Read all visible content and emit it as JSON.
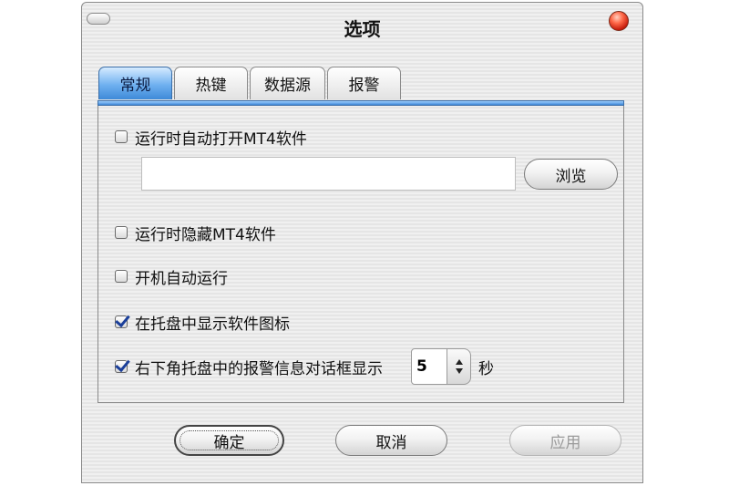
{
  "window": {
    "title": "选项"
  },
  "tabs": [
    {
      "label": "常规",
      "active": true
    },
    {
      "label": "热键",
      "active": false
    },
    {
      "label": "数据源",
      "active": false
    },
    {
      "label": "报警",
      "active": false
    }
  ],
  "general": {
    "auto_open_mt4": {
      "label": "运行时自动打开MT4软件",
      "checked": false
    },
    "mt4_path": {
      "value": "",
      "placeholder": ""
    },
    "browse_label": "浏览",
    "hide_mt4": {
      "label": "运行时隐藏MT4软件",
      "checked": false
    },
    "startup": {
      "label": "开机自动运行",
      "checked": false
    },
    "tray_icon": {
      "label": "在托盘中显示软件图标",
      "checked": true
    },
    "tray_alert": {
      "label": "右下角托盘中的报警信息对话框显示",
      "checked": true,
      "seconds": "5",
      "unit": "秒"
    }
  },
  "buttons": {
    "ok": "确定",
    "cancel": "取消",
    "apply": "应用"
  },
  "colors": {
    "tab_active": "#6fb0f0",
    "check_mark": "#1b3f9a",
    "close_button": "#e0321a"
  }
}
